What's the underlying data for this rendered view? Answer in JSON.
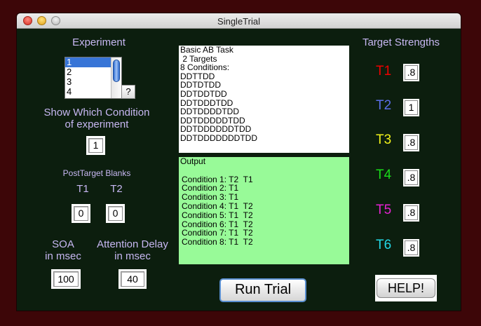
{
  "window": {
    "title": "SingleTrial"
  },
  "experiment": {
    "heading": "Experiment",
    "list": [
      "1",
      "2",
      "3",
      "4"
    ],
    "selected_index": 0,
    "help_label": "?"
  },
  "condition": {
    "heading_line1": "Show Which Condition",
    "heading_line2": "of experiment",
    "value": "1"
  },
  "blanks": {
    "heading": "PostTarget Blanks",
    "t1_label": "T1",
    "t2_label": "T2",
    "t1_value": "0",
    "t2_value": "0"
  },
  "soa": {
    "label_line1": "SOA",
    "label_line2": "in msec",
    "value": "100"
  },
  "attention": {
    "label_line1": "Attention Delay",
    "label_line2": "in msec",
    "value": "40"
  },
  "task_text": [
    "Basic AB Task",
    " 2 Targets",
    "8 Conditions:",
    "DDTTDD",
    "DDTDTDD",
    "DDTDDTDD",
    "DDTDDDTDD",
    "DDTDDDDTDD",
    "DDTDDDDDTDD",
    "DDTDDDDDDTDD",
    "DDTDDDDDDDTDD"
  ],
  "output": {
    "heading": "Output",
    "lines": [
      "Condition 1: T2  T1",
      "Condition 2: T1",
      "Condition 3: T1",
      "Condition 4: T1  T2",
      "Condition 5: T1  T2",
      "Condition 6: T1  T2",
      "Condition 7: T1  T2",
      "Condition 8: T1  T2"
    ]
  },
  "run_button_label": "Run Trial",
  "help_button_label": "HELP!",
  "targets": {
    "heading": "Target Strengths",
    "items": [
      {
        "label": "T1",
        "value": ".8",
        "color": "#ee0000"
      },
      {
        "label": "T2",
        "value": "1",
        "color": "#5a6ee8"
      },
      {
        "label": "T3",
        "value": ".8",
        "color": "#f2f21a"
      },
      {
        "label": "T4",
        "value": ".8",
        "color": "#1adc1a"
      },
      {
        "label": "T5",
        "value": ".8",
        "color": "#e622d2"
      },
      {
        "label": "T6",
        "value": ".8",
        "color": "#22d8e6"
      }
    ]
  }
}
